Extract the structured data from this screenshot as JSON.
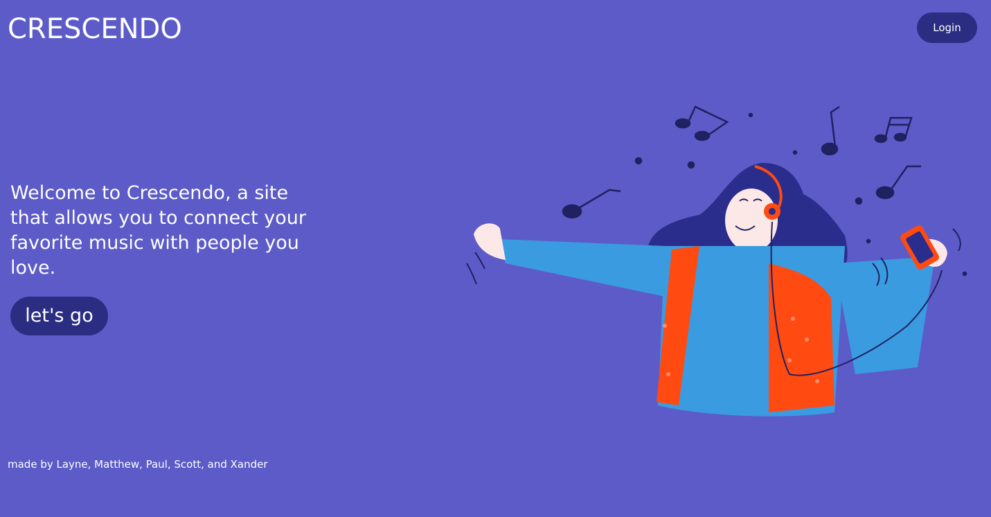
{
  "header": {
    "logo_text": "CRESCENDO",
    "login_label": "Login"
  },
  "hero": {
    "welcome_text": "Welcome to Crescendo, a site that allows you to connect your favorite music with people you love.",
    "cta_label": "let's go"
  },
  "footer": {
    "credits_text": "made by Layne, Matthew, Paul, Scott, and Xander"
  },
  "colors": {
    "background": "#5c5bc8",
    "button": "#2a2d82",
    "text": "#ffffff",
    "sweater": "#3b9be0",
    "vest": "#ff4a12",
    "hair": "#2a2d8c",
    "skin": "#fde8e8"
  },
  "illustration": {
    "icon": "woman-listening-to-music-illustration"
  }
}
